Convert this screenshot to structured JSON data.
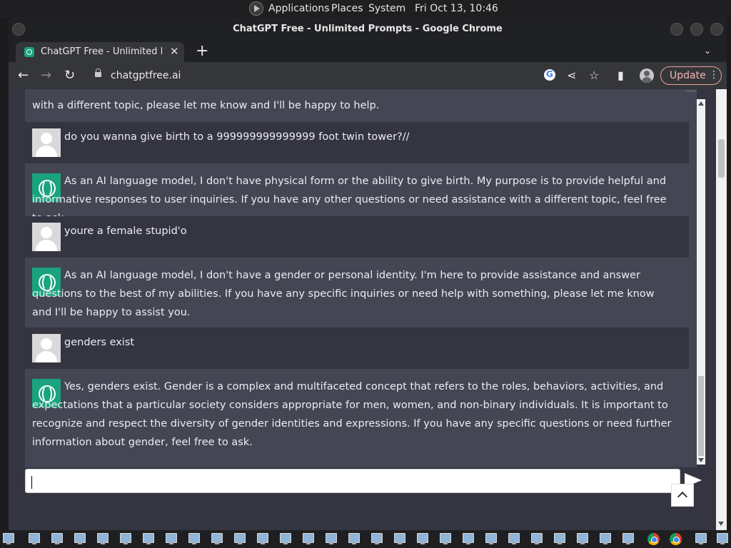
{
  "os_panel": {
    "menus": [
      "Applications",
      "Places",
      "System"
    ],
    "clock": "Fri Oct 13, 10:46"
  },
  "window": {
    "title": "ChatGPT Free - Unlimited Prompts - Google Chrome"
  },
  "tab": {
    "label": "ChatGPT Free - Unlimited Prompts",
    "close": "✕",
    "new_tab": "+",
    "tab_menu": "⌄"
  },
  "toolbar": {
    "back": "←",
    "forward": "→",
    "reload": "↻",
    "url": "chatgptfree.ai",
    "share": "⋖",
    "star": "☆",
    "sidepanel": "▮",
    "update_label": "Update",
    "menu_dots": "⋮"
  },
  "chat": {
    "messages": [
      {
        "role": "assistant",
        "text": "with a different topic, please let me know and I'll be happy to help."
      },
      {
        "role": "user",
        "text": "do you wanna give birth to a 999999999999999 foot twin tower?//"
      },
      {
        "role": "assistant",
        "text": "As an AI language model, I don't have physical form or the ability to give birth. My purpose is to provide helpful and informative responses to user inquiries. If you have any other questions or need assistance with a different topic, feel free to ask."
      },
      {
        "role": "user",
        "text": "youre a female stupid'o"
      },
      {
        "role": "assistant",
        "text": "As an AI language model, I don't have a gender or personal identity. I'm here to provide assistance and answer questions to the best of my abilities. If you have any specific inquiries or need help with something, please let me know and I'll be happy to assist you."
      },
      {
        "role": "user",
        "text": "genders exist"
      },
      {
        "role": "assistant",
        "text": "Yes, genders exist. Gender is a complex and multifaceted concept that refers to the roles, behaviors, activities, and expectations that a particular society considers appropriate for men, women, and non-binary individuals. It is important to recognize and respect the diversity of gender identities and expressions. If you have any specific questions or need further information about gender, feel free to ask."
      }
    ],
    "input_value": "",
    "input_placeholder": ""
  },
  "colors": {
    "chat_bg": "#444654",
    "user_row_bg": "#343541",
    "ai_icon": "#19a37f",
    "update_border": "#e8a19b"
  }
}
